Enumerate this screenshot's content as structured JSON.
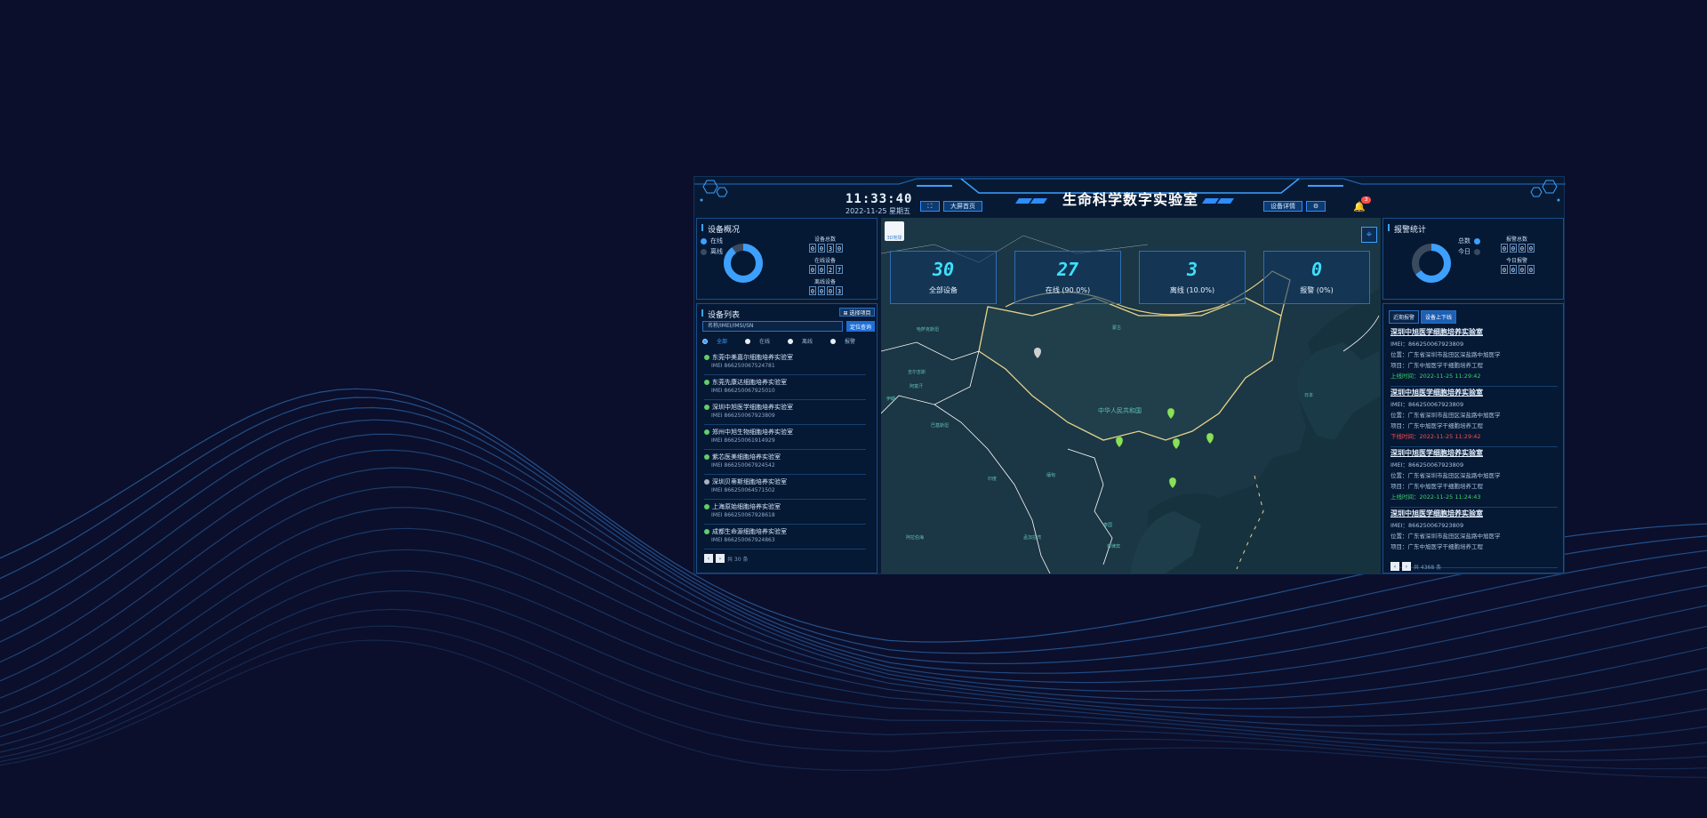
{
  "header": {
    "time": "11:33:40",
    "date": "2022-11-25 星期五",
    "title": "生命科学数字实验室",
    "btn_fullscreen": "⛶",
    "btn_bigscreen": "大屏首页",
    "btn_device_detail": "设备详情",
    "btn_settings": "⚙",
    "bell_badge": "3"
  },
  "overview": {
    "title": "设备概况",
    "legend_online": "在线",
    "legend_offline": "离线",
    "donut_online_fraction": 0.9,
    "total_label": "设备总数",
    "total_digits": [
      "0",
      "0",
      "3",
      "0"
    ],
    "online_label": "在线设备",
    "online_digits": [
      "0",
      "0",
      "2",
      "7"
    ],
    "offline_label": "离线设备",
    "offline_digits": [
      "0",
      "0",
      "0",
      "3"
    ]
  },
  "devlist": {
    "title": "设备列表",
    "select_project": "⊞ 选择项目",
    "search_placeholder": "名称/IMEI/IMSI/SN",
    "locate_btn": "定位查询",
    "filters": [
      "全部",
      "在线",
      "离线",
      "报警"
    ],
    "items": [
      {
        "name": "东莞中美嘉尔细胞培养实验室",
        "imei": "IMEI 866250067524781",
        "online": true
      },
      {
        "name": "东莞先康达细胞培养实验室",
        "imei": "IMEI 866250067925010",
        "online": true
      },
      {
        "name": "深圳中旭医学细胞培养实验室",
        "imei": "IMEI 866250067923809",
        "online": true
      },
      {
        "name": "郑州中旭生物细胞培养实验室",
        "imei": "IMEI 866250061914929",
        "online": true
      },
      {
        "name": "紫芯医美细胞培养实验室",
        "imei": "IMEI 866250067924542",
        "online": true
      },
      {
        "name": "深圳贝蒂斯细胞培养实验室",
        "imei": "IMEI 866250064571502",
        "online": false
      },
      {
        "name": "上海原始细胞培养实验室",
        "imei": "IMEI 866250067928618",
        "online": true
      },
      {
        "name": "成都生命源细胞培养实验室",
        "imei": "IMEI 866250067924863",
        "online": true
      }
    ],
    "pager_text": "共 30 条"
  },
  "map": {
    "logo_text": "3D地球",
    "locate_icon": "⌖",
    "kpis": [
      {
        "value": "30",
        "label": "全部设备"
      },
      {
        "value": "27",
        "label": "在线 (90.0%)"
      },
      {
        "value": "3",
        "label": "离线 (10.0%)"
      },
      {
        "value": "0",
        "label": "报警 (0%)"
      }
    ],
    "labels": {
      "china": "中华人民共和国",
      "mongolia": "蒙古",
      "kazakh": "哈萨克斯坦",
      "afghan": "阿富汗",
      "iran": "伊朗",
      "pakistan": "巴基斯坦",
      "india": "印度",
      "myanmar": "缅甸",
      "thailand": "泰国",
      "philippines": "菲律宾",
      "japan": "日本",
      "arabian": "阿拉伯海",
      "bengal": "孟加拉湾",
      "kyrgyz": "吉尔吉斯"
    }
  },
  "alarm_stats": {
    "title": "报警统计",
    "legend_total": "总数",
    "legend_today": "今日",
    "total_label": "报警总数",
    "total_digits": [
      "0",
      "0",
      "0",
      "0"
    ],
    "today_label": "今日报警",
    "today_digits": [
      "0",
      "0",
      "0",
      "0"
    ]
  },
  "alarm_list": {
    "tab_recent": "近期报警",
    "tab_online": "设备上下线",
    "items": [
      {
        "title": "深圳中旭医学细胞培养实验室",
        "imei": "IMEI：866250067923809",
        "loc": "位置：广东省深圳市盐田区深盐路中旭医学",
        "proj": "项目：广东中旭医学干细胞培养工程",
        "time": "上线时间：2022-11-25 11:29:42",
        "status": "online"
      },
      {
        "title": "深圳中旭医学细胞培养实验室",
        "imei": "IMEI：866250067923809",
        "loc": "位置：广东省深圳市盐田区深盐路中旭医学",
        "proj": "项目：广东中旭医学干细胞培养工程",
        "time": "下线时间：2022-11-25 11:29:42",
        "status": "offline"
      },
      {
        "title": "深圳中旭医学细胞培养实验室",
        "imei": "IMEI：866250067923809",
        "loc": "位置：广东省深圳市盐田区深盐路中旭医学",
        "proj": "项目：广东中旭医学干细胞培养工程",
        "time": "上线时间：2022-11-25 11:24:43",
        "status": "online"
      },
      {
        "title": "深圳中旭医学细胞培养实验室",
        "imei": "IMEI：866250067923809",
        "loc": "位置：广东省深圳市盐田区深盐路中旭医学",
        "proj": "项目：广东中旭医学干细胞培养工程",
        "time": "",
        "status": "online"
      }
    ],
    "pager_text": "共 4368 条"
  },
  "colors": {
    "online": "#3da0ff",
    "offline": "#3a4a5e",
    "online_text": "#3dd46a",
    "offline_text": "#ff4d4d",
    "accent": "#3ee0ff"
  }
}
